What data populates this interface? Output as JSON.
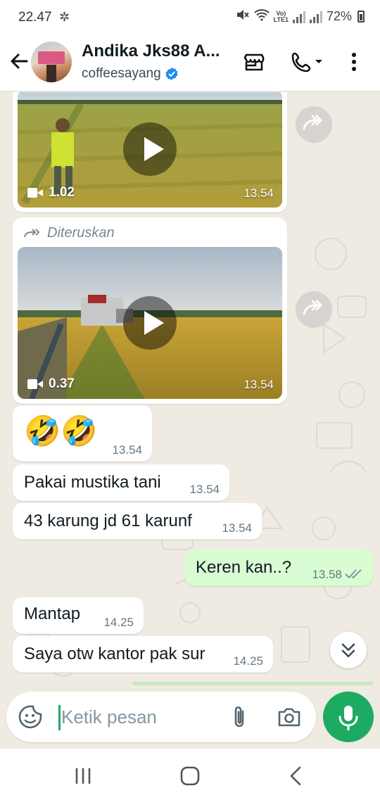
{
  "status_bar": {
    "time": "22.47",
    "network_label": "LTE1",
    "volte_label": "Vo)",
    "battery": "72%"
  },
  "header": {
    "contact_name": "Andika Jks88 A...",
    "subtitle": "coffeesayang",
    "verified": true,
    "icons": [
      "back-arrow-icon",
      "shop-icon",
      "phone-call-icon",
      "more-vert-icon"
    ]
  },
  "messages": [
    {
      "type": "video",
      "direction": "in",
      "duration": "1.02",
      "time": "13.54",
      "forwarded_label": ""
    },
    {
      "type": "video",
      "direction": "in",
      "forwarded_label": "Diteruskan",
      "duration": "0.37",
      "time": "13.54"
    },
    {
      "type": "text",
      "direction": "in",
      "text": "🤣🤣",
      "time": "13.54"
    },
    {
      "type": "text",
      "direction": "in",
      "text": "Pakai mustika tani",
      "time": "13.54"
    },
    {
      "type": "text",
      "direction": "in",
      "text": "43 karung jd 61 karunf",
      "time": "13.54"
    },
    {
      "type": "text",
      "direction": "out",
      "text": "Keren kan..?",
      "time": "13.58",
      "status": "read"
    },
    {
      "type": "text",
      "direction": "in",
      "text": "Mantap",
      "time": "14.25"
    },
    {
      "type": "text",
      "direction": "in",
      "text": "Saya otw kantor pak sur",
      "time": "14.25"
    }
  ],
  "composer": {
    "placeholder": "Ketik pesan"
  },
  "colors": {
    "accent": "#1daa61",
    "outgoing_bubble": "#d9fdd3",
    "chat_background": "#efeae2",
    "verified_badge": "#1b8ef2"
  }
}
